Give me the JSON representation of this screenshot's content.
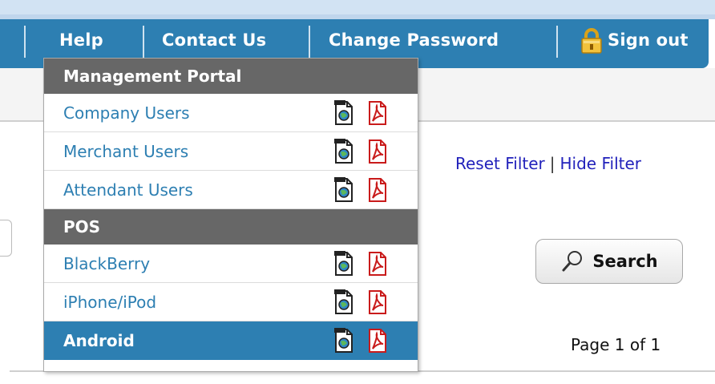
{
  "navbar": {
    "items": [
      {
        "label": "Help"
      },
      {
        "label": "Contact Us"
      },
      {
        "label": "Change Password"
      },
      {
        "label": "Sign out"
      }
    ]
  },
  "filters": {
    "reset_label": "Reset Filter",
    "separator": "|",
    "hide_label": "Hide Filter"
  },
  "search": {
    "button_label": "Search"
  },
  "pagination": {
    "text": "Page 1 of 1"
  },
  "menu": {
    "sections": [
      {
        "title": "Management Portal",
        "items": [
          {
            "label": "Company Users",
            "icons": [
              "web-document-icon",
              "pdf-icon"
            ]
          },
          {
            "label": "Merchant Users",
            "icons": [
              "web-document-icon",
              "pdf-icon"
            ]
          },
          {
            "label": "Attendant Users",
            "icons": [
              "web-document-icon",
              "pdf-icon"
            ]
          }
        ]
      },
      {
        "title": "POS",
        "items": [
          {
            "label": "BlackBerry",
            "icons": [
              "web-document-icon",
              "pdf-icon"
            ]
          },
          {
            "label": "iPhone/iPod",
            "icons": [
              "web-document-icon",
              "pdf-icon"
            ]
          },
          {
            "label": "Android",
            "icons": [
              "web-document-icon",
              "pdf-icon"
            ],
            "selected": true
          }
        ]
      }
    ]
  },
  "colors": {
    "navbar_bg": "#2d7fb2",
    "menu_header_bg": "#676767",
    "selected_bg": "#2d7fb2",
    "link_color": "#2d7fb2",
    "filter_link_color": "#2222bb"
  }
}
